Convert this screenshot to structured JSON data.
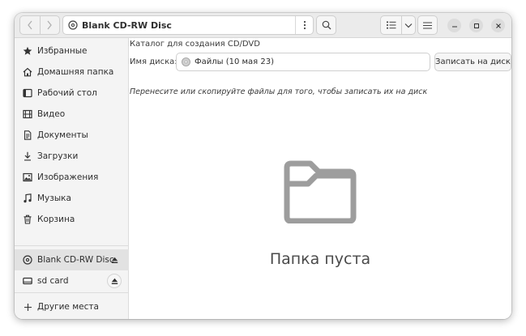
{
  "window": {
    "title": "Blank CD-RW Disc"
  },
  "headerbar": {
    "back_icon": "chevron-left-icon",
    "forward_icon": "chevron-right-icon",
    "location_icon": "disc-icon",
    "location_label": "Blank CD-RW Disc",
    "location_menu_icon": "vertical-dots-icon",
    "search_icon": "search-icon",
    "view_icon": "list-view-icon",
    "view_dropdown_icon": "chevron-down-icon",
    "main_menu_icon": "hamburger-menu-icon",
    "minimize_icon": "minimize-icon",
    "maximize_icon": "maximize-icon",
    "close_icon": "close-icon"
  },
  "sidebar": {
    "places": [
      {
        "label": "Избранные",
        "icon": "star-icon"
      },
      {
        "label": "Домашняя папка",
        "icon": "home-icon"
      },
      {
        "label": "Рабочий стол",
        "icon": "desktop-icon"
      },
      {
        "label": "Видео",
        "icon": "video-icon"
      },
      {
        "label": "Документы",
        "icon": "document-icon"
      },
      {
        "label": "Загрузки",
        "icon": "download-icon"
      },
      {
        "label": "Изображения",
        "icon": "image-icon"
      },
      {
        "label": "Музыка",
        "icon": "music-icon"
      },
      {
        "label": "Корзина",
        "icon": "trash-icon"
      }
    ],
    "devices": [
      {
        "label": "Blank CD-RW Disc",
        "icon": "disc-icon",
        "eject_icon": "eject-icon",
        "active": true
      },
      {
        "label": "sd card",
        "icon": "drive-icon",
        "eject_icon": "eject-icon",
        "active": false
      }
    ],
    "other_locations": {
      "label": "Другие места",
      "icon": "plus-icon"
    }
  },
  "content": {
    "cd_title": "Каталог для создания CD/DVD",
    "disk_name_label": "Имя диска:",
    "disk_name_value": "Файлы (10 мая 23)",
    "burn_button": "Записать на диск",
    "hint": "Перенесите или скопируйте файлы для того, чтобы записать их на диск",
    "empty_icon": "folder-icon",
    "empty_text": "Папка пуста"
  }
}
